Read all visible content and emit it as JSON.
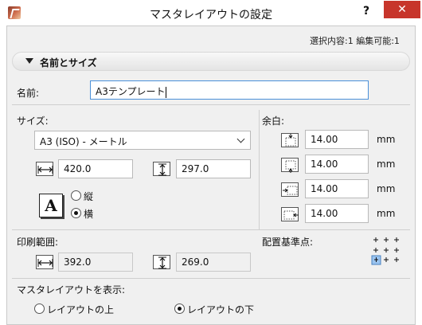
{
  "window": {
    "title": "マスタレイアウトの設定",
    "help_label": "?",
    "close_label": "✕"
  },
  "status": {
    "text": "選択内容:1 編集可能:1"
  },
  "section": {
    "title": "名前とサイズ"
  },
  "name_field": {
    "label": "名前:",
    "value": "A3テンプレート"
  },
  "size": {
    "label": "サイズ:",
    "selected": "A3 (ISO) - メートル",
    "width": "420.0",
    "height": "297.0",
    "orientation": {
      "portrait_label": "縦",
      "landscape_label": "横",
      "selected": "landscape",
      "icon_glyph": "A"
    }
  },
  "margins": {
    "label": "余白:",
    "top": "14.00",
    "bottom": "14.00",
    "left": "14.00",
    "right": "14.00",
    "unit": "mm"
  },
  "print_area": {
    "label": "印刷範囲:",
    "width": "392.0",
    "height": "269.0"
  },
  "anchor": {
    "label": "配置基準点:",
    "selected": "bottom-left"
  },
  "display": {
    "label": "マスタレイアウトを表示:",
    "above_label": "レイアウトの上",
    "below_label": "レイアウトの下",
    "selected": "below"
  }
}
